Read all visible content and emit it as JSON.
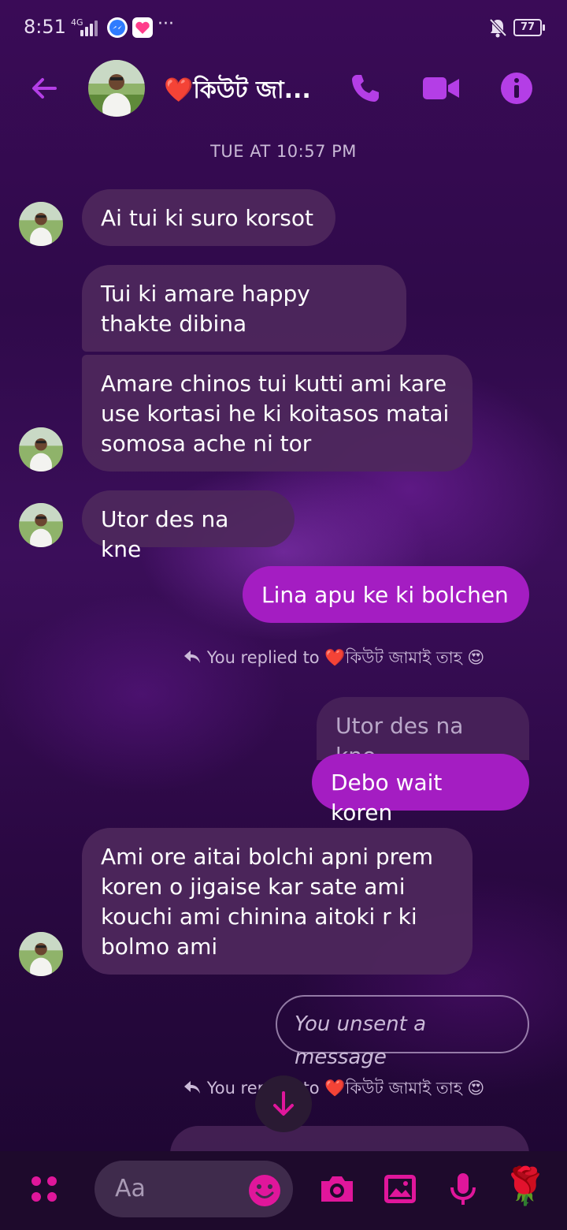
{
  "status_bar": {
    "time": "8:51",
    "network": "4G",
    "battery": "77",
    "overflow": "···"
  },
  "header": {
    "title": "❤️কিউট জা...",
    "back_icon": "arrow-left-icon",
    "call_icon": "phone-icon",
    "video_icon": "video-camera-icon",
    "info_icon": "info-icon"
  },
  "conversation": {
    "timestamp": "TUE AT 10:57 PM",
    "messages": [
      {
        "from": "them",
        "text": "Ai tui ki suro korsot"
      },
      {
        "from": "them",
        "text": "Tui ki amare happy thakte dibina"
      },
      {
        "from": "them",
        "text": "Amare chinos tui kutti ami kare use kortasi he ki koitasos matai somosa ache ni tor"
      },
      {
        "from": "them",
        "text": "Utor des na kne"
      },
      {
        "from": "me",
        "text": "Lina apu ke ki bolchen"
      },
      {
        "from": "me",
        "reply_note": "You replied to ❤️কিউট জামাই তাহ 😍",
        "quoted": "Utor des na kne",
        "text": "Debo wait koren"
      },
      {
        "from": "them",
        "text": "Ami ore aitai bolchi apni prem koren o jigaise kar sate ami kouchi ami chinina aitoki r ki bolmo ami"
      },
      {
        "from": "me",
        "text": "You unsent a message"
      },
      {
        "from": "me",
        "reply_note": "You replied to ❤️কিউট জামাই তাহ 😍"
      }
    ]
  },
  "composer": {
    "placeholder": "Aa",
    "menu_icon": "four-dots-icon",
    "emoji_icon": "smiley-icon",
    "camera_icon": "camera-icon",
    "gallery_icon": "image-icon",
    "mic_icon": "microphone-icon",
    "quick_reaction": "🌹"
  },
  "colors": {
    "accent": "#a41dc2",
    "icon_accent": "#b43ee6",
    "composer_pink": "#e0169b"
  }
}
